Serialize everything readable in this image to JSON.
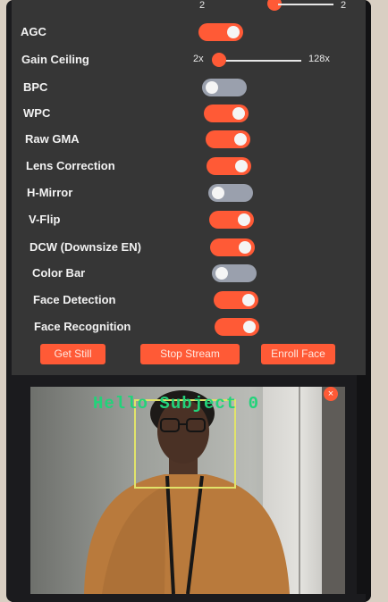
{
  "settings": {
    "top_partial": {
      "min_label": "2",
      "max_label": "2"
    },
    "rows": [
      {
        "label": "AGC",
        "type": "toggle",
        "on": true
      },
      {
        "label": "Gain Ceiling",
        "type": "slider",
        "min_label": "2x",
        "max_label": "128x",
        "value": 2
      },
      {
        "label": "BPC",
        "type": "toggle",
        "on": false
      },
      {
        "label": "WPC",
        "type": "toggle",
        "on": true
      },
      {
        "label": "Raw GMA",
        "type": "toggle",
        "on": true
      },
      {
        "label": "Lens Correction",
        "type": "toggle",
        "on": true
      },
      {
        "label": "H-Mirror",
        "type": "toggle",
        "on": false
      },
      {
        "label": "V-Flip",
        "type": "toggle",
        "on": true
      },
      {
        "label": "DCW (Downsize EN)",
        "type": "toggle",
        "on": true
      },
      {
        "label": "Color Bar",
        "type": "toggle",
        "on": false
      },
      {
        "label": "Face Detection",
        "type": "toggle",
        "on": true
      },
      {
        "label": "Face Recognition",
        "type": "toggle",
        "on": true
      }
    ]
  },
  "buttons": {
    "get_still": "Get Still",
    "stop_stream": "Stop Stream",
    "enroll_face": "Enroll Face"
  },
  "stream": {
    "overlay_text": "Hello Subject 0",
    "close_symbol": "×"
  },
  "colors": {
    "accent": "#ff5a36",
    "panel": "#363636",
    "toggle_off": "#9aa0ad",
    "overlay_text": "#22d37a",
    "face_box": "#e1e36a"
  },
  "icons": {
    "close": "close-icon"
  }
}
